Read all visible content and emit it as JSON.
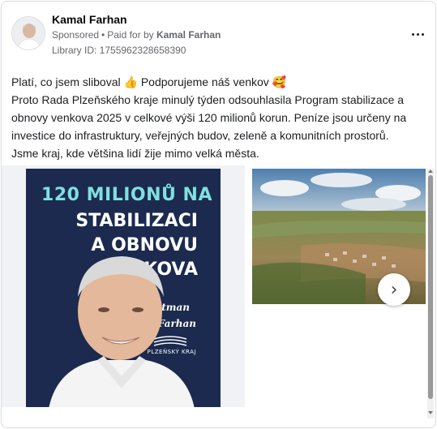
{
  "advertiser": {
    "name": "Kamal Farhan",
    "sponsored": "Sponsored",
    "separator": "•",
    "paid_for_prefix": "Paid for by",
    "paid_for_name": "Kamal Farhan",
    "library_id": "Library ID: 1755962328658390",
    "avatar_icon": "avatar-photo",
    "more_icon": "more-dots-icon"
  },
  "post": {
    "text": "Platí, co jsem sliboval 👍 Podporujeme náš venkov 🥰\nProto Rada Plzeňského kraje minulý týden odsouhlasila Program stabilizace a obnovy venkova 2025 v celkové výši 120 milionů korun. Peníze jsou určeny na investice do infrastruktury, veřejných budov, zeleně a komunitních prostorů. Jsme kraj, kde většina lidí žije mimo velká města."
  },
  "carousel": {
    "slide1": {
      "line1": "120 MILIONŮ NA",
      "line2": "STABILIZACI",
      "line3": "A OBNOVU",
      "line4": "VENKOVA",
      "signature1": "Váš hejtman",
      "signature2": "Kamal Farhan",
      "region": "PLZEŇSKÝ KRAJ"
    },
    "slide2_icon": "landscape-photo",
    "next_icon": "chevron-right-icon",
    "next_glyph": "›"
  },
  "colors": {
    "poster_bg": "#1b2a4e",
    "poster_accent": "#7fe0e0"
  }
}
